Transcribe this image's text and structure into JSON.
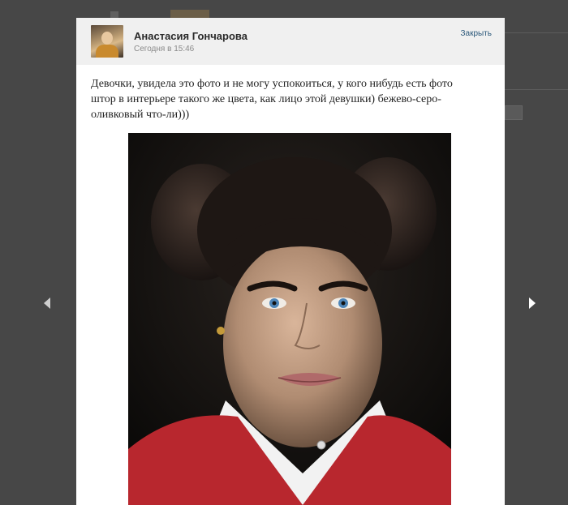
{
  "post": {
    "author": "Анастасия Гончарова",
    "timestamp": "Сегодня в 15:46",
    "close_label": "Закрыть",
    "text": "Девочки, увидела это фото и не могу успокоиться, у кого нибудь есть фото штор в интерьере такого же цвета, как лицо этой девушки) бежево-серо-оливковый что-ли)))"
  },
  "icons": {
    "prev": "chevron-left-icon",
    "next": "chevron-right-icon"
  },
  "colors": {
    "overlay": "#474747",
    "header_bg": "#f0f0f0",
    "link": "#2b587a"
  }
}
